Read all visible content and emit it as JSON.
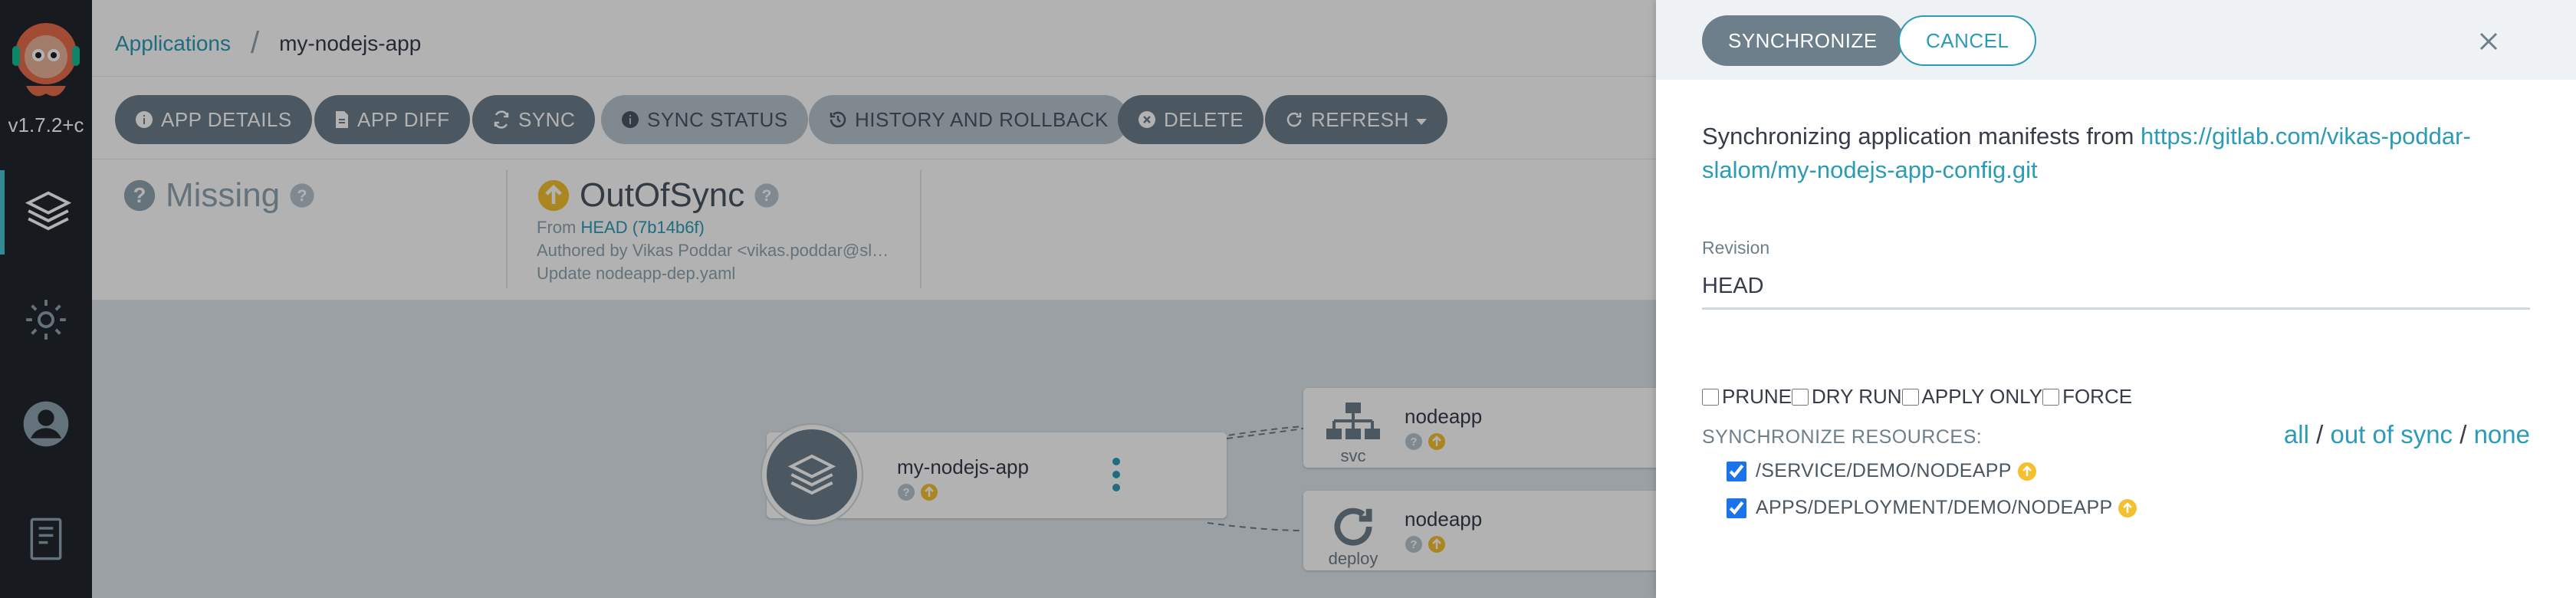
{
  "nav": {
    "version": "v1.7.2+c"
  },
  "breadcrumb": {
    "root": "Applications",
    "current": "my-nodejs-app"
  },
  "toolbar": {
    "app_details": "APP DETAILS",
    "app_diff": "APP DIFF",
    "sync": "SYNC",
    "sync_status": "SYNC STATUS",
    "history": "HISTORY AND ROLLBACK",
    "delete": "DELETE",
    "refresh": "REFRESH"
  },
  "status": {
    "health": "Missing",
    "sync": "OutOfSync",
    "from_label": "From",
    "revision": "HEAD (7b14b6f)",
    "author": "Authored by Vikas Poddar <vikas.poddar@sl…",
    "commit_message": "Update nodeapp-dep.yaml"
  },
  "graph": {
    "app_name": "my-nodejs-app",
    "nodes": [
      {
        "name": "nodeapp",
        "kind": "svc"
      },
      {
        "name": "nodeapp",
        "kind": "deploy"
      }
    ]
  },
  "panel": {
    "synchronize": "SYNCHRONIZE",
    "cancel": "CANCEL",
    "description_prefix": "Synchronizing application manifests from ",
    "repo_url": "https://gitlab.com/vikas-poddar-slalom/my-nodejs-app-config.git",
    "revision_label": "Revision",
    "revision_value": "HEAD",
    "options": {
      "prune": "PRUNE",
      "dry_run": "DRY RUN",
      "apply_only": "APPLY ONLY",
      "force": "FORCE"
    },
    "resources_title": "SYNCHRONIZE RESOURCES:",
    "filter_all": "all",
    "filter_out_of_sync": "out of sync",
    "filter_none": "none",
    "resources": [
      "/SERVICE/DEMO/NODEAPP",
      "APPS/DEPLOYMENT/DEMO/NODEAPP"
    ]
  },
  "colors": {
    "accent": "#2c9bb5",
    "button": "#6d7f8b",
    "warning": "#f4c030",
    "nav": "#22272e"
  }
}
